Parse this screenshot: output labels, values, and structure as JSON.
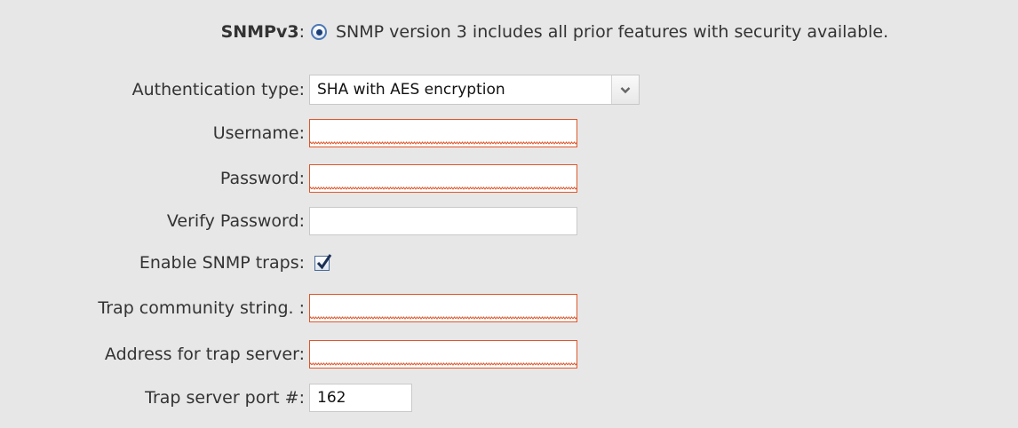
{
  "snmp": {
    "label": "SNMPv3",
    "colon": ":",
    "description": "SNMP version 3 includes all prior features with security available.",
    "selected": true
  },
  "form": {
    "auth_type": {
      "label": "Authentication type:",
      "value": "SHA with AES encryption"
    },
    "username": {
      "label": "Username:",
      "value": ""
    },
    "password": {
      "label": "Password:",
      "value": ""
    },
    "verify_password": {
      "label": "Verify Password:",
      "value": ""
    },
    "enable_traps": {
      "label": "Enable SNMP traps:",
      "checked": true
    },
    "trap_community": {
      "label": "Trap community string. :",
      "value": ""
    },
    "trap_address": {
      "label": "Address for trap server:",
      "value": ""
    },
    "trap_port": {
      "label": "Trap server port #:",
      "value": "162"
    }
  },
  "colors": {
    "invalid_border": "#e0562a",
    "radio_accent": "#4a77b5"
  },
  "icons": {
    "select_arrow": "chevron-down-icon",
    "checkbox_mark": "check-icon"
  }
}
